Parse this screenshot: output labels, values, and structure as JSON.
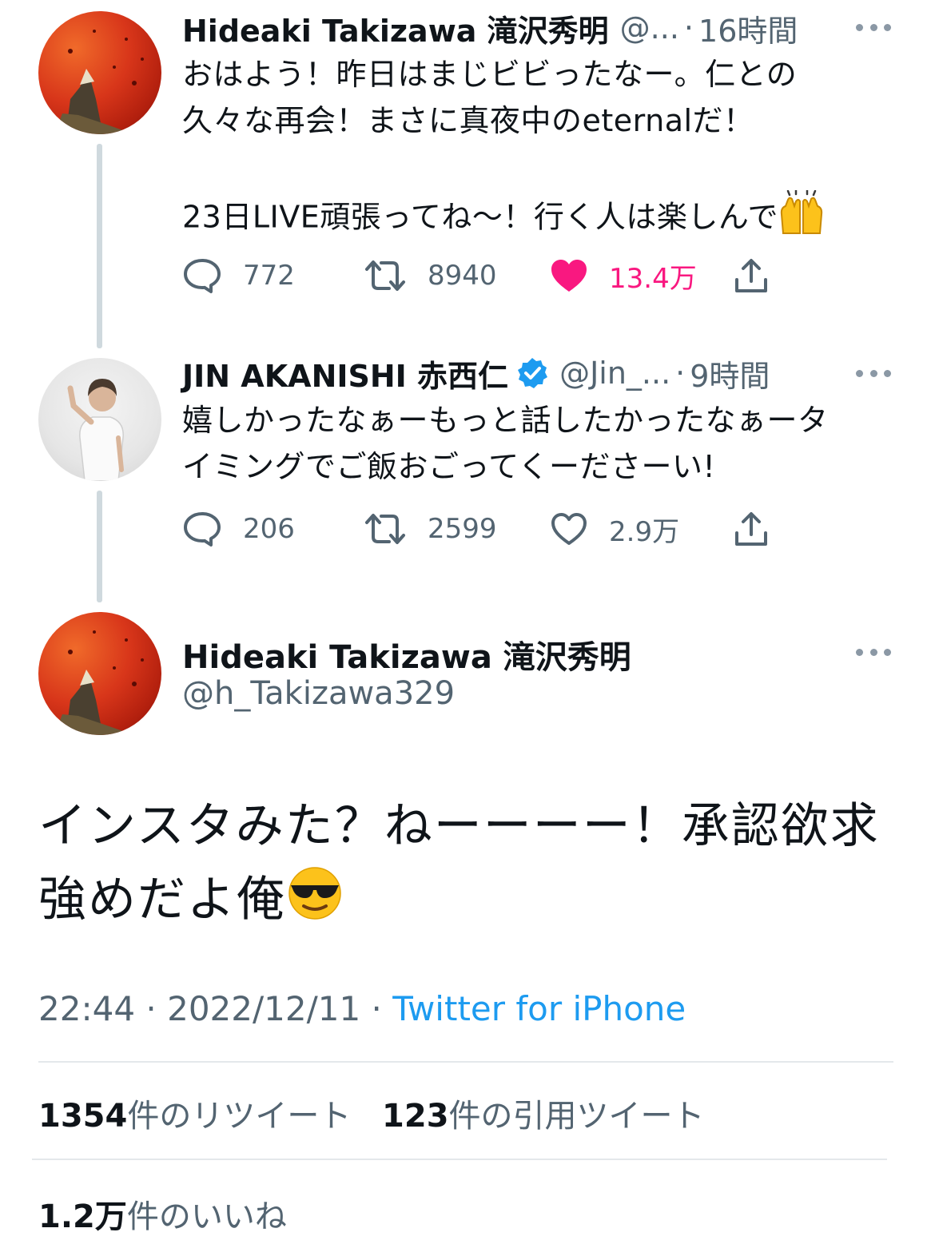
{
  "thread": [
    {
      "display_name": "Hideaki Takizawa 滝沢秀明",
      "handle": "@...",
      "time": "16時間",
      "text_line1": "おはよう！昨日はまじビビったなー。仁との",
      "text_line2": "久々な再会！まさに真夜中のeternalだ！",
      "text_line3": "",
      "text_line4": "23日LIVE頑張ってね〜！行く人は楽しんで",
      "emoji": "raising-hands",
      "replies": "772",
      "retweets": "8940",
      "likes": "13.4万",
      "liked": true
    },
    {
      "display_name": "JIN AKANISHI 赤西仁",
      "verified": true,
      "handle": "@Jin_...",
      "time": "9時間",
      "text_line1": "嬉しかったなぁーもっと話したかったなぁータ",
      "text_line2": "イミングでご飯おごってくーださーい!",
      "replies": "206",
      "retweets": "2599",
      "likes": "2.9万",
      "liked": false
    }
  ],
  "main_tweet": {
    "display_name": "Hideaki Takizawa 滝沢秀明",
    "handle": "@h_Takizawa329",
    "text_line1": "インスタみた？ねーーーー！承認欲求",
    "text_line2": "強めだよ俺",
    "emoji": "smiling-face-with-sunglasses",
    "time": "22:44",
    "sep": " · ",
    "date": "2022/12/11",
    "source": "Twitter for iPhone"
  },
  "stats": {
    "retweets_count": "1354",
    "retweets_label": "件のリツイート",
    "quotes_count": "123",
    "quotes_label": "件の引用ツイート",
    "likes_count": "1.2万",
    "likes_label": "件のいいね"
  },
  "colors": {
    "like": "#f91880",
    "link": "#1d9bf0",
    "verified": "#1d9bf0",
    "secondary_text": "#536471"
  }
}
